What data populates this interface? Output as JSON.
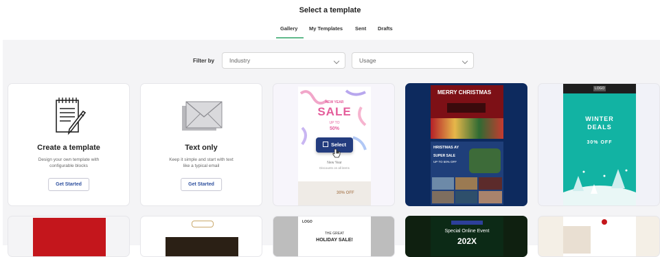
{
  "page": {
    "title": "Select a template"
  },
  "tabs": [
    {
      "label": "Gallery",
      "active": true
    },
    {
      "label": "My Templates",
      "active": false
    },
    {
      "label": "Sent",
      "active": false
    },
    {
      "label": "Drafts",
      "active": false
    }
  ],
  "filter": {
    "label": "Filter by",
    "industry_value": "Industry",
    "usage_value": "Usage"
  },
  "cards": {
    "create": {
      "title": "Create a template",
      "desc_line1": "Design your own template with",
      "desc_line2": "configurable blocks",
      "button": "Get Started"
    },
    "text_only": {
      "title": "Text only",
      "desc_line1": "Keep it simple and start with text",
      "desc_line2": "like a typical email",
      "button": "Get Started"
    },
    "new_year": {
      "heading": "NEW YEAR",
      "sale": "SALE",
      "up_to": "UP TO",
      "percent": "50%",
      "select_label": "Select",
      "body_line1": "New Year",
      "body_line2": "Discounts on all items",
      "off": "30% OFF"
    },
    "christmas": {
      "heading": "MERRY CHRISTMAS",
      "sub_heading": "HRISTMAS  AY",
      "super_sale": "SUPER SALE",
      "upto": "UP TO 50% OFF"
    },
    "winter": {
      "logo": "LOGO",
      "line1": "WINTER",
      "line2": "DEALS",
      "offer": "30% OFF"
    }
  },
  "bottom_row": {
    "card3": {
      "logo": "LOGO",
      "line1": "THE GREAT",
      "line2": "HOLIDAY SALE!"
    },
    "card4": {
      "event": "Special Online Event",
      "year": "202X"
    }
  },
  "colors": {
    "accent": "#5fb98a",
    "select_button": "#233c7e",
    "link_blue": "#2d4f9e",
    "christmas_navy": "#0d2a5e",
    "winter_teal": "#12b3a3"
  }
}
